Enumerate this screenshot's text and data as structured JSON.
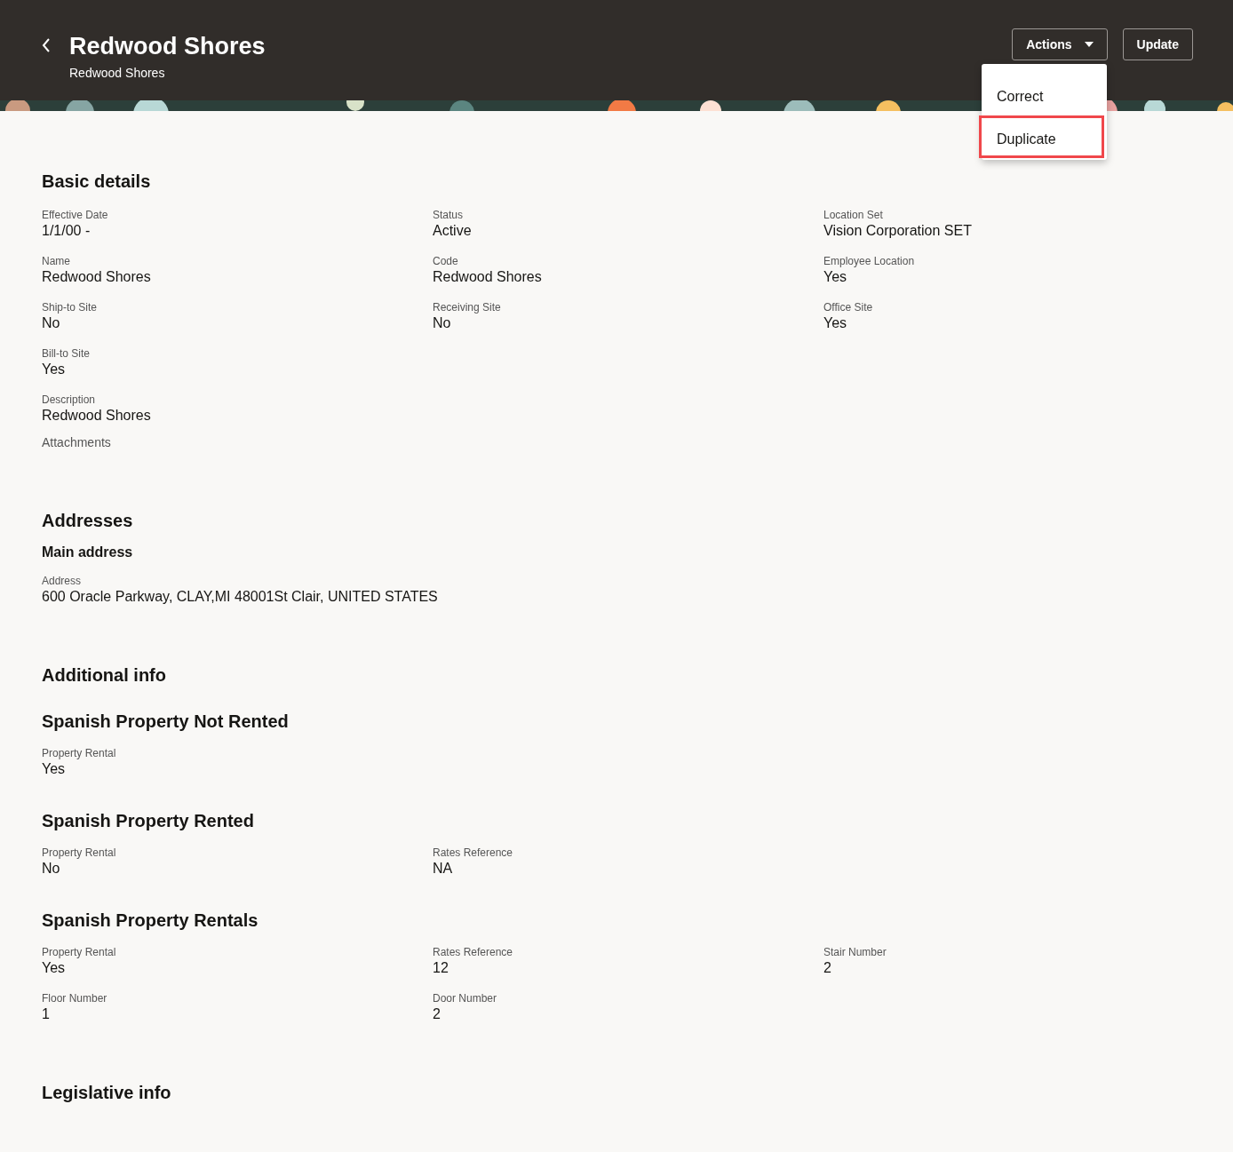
{
  "header": {
    "title": "Redwood Shores",
    "subtitle": "Redwood Shores",
    "buttons": [
      {
        "label": "Actions",
        "kind": "dropdown"
      },
      {
        "label": "Update",
        "kind": "plain"
      }
    ]
  },
  "menu": {
    "items": [
      {
        "label": "Correct",
        "selected": false
      },
      {
        "label": "Duplicate",
        "selected": true
      }
    ]
  },
  "blocks": [
    {
      "kind": "heading",
      "text": "Basic details"
    },
    {
      "kind": "fields",
      "rows": [
        [
          {
            "label": "Effective Date",
            "value": "1/1/00 -"
          },
          {
            "label": "Status",
            "value": "Active"
          },
          {
            "label": "Location Set",
            "value": "Vision Corporation SET"
          }
        ],
        [
          {
            "label": "Name",
            "value": "Redwood Shores"
          },
          {
            "label": "Code",
            "value": "Redwood Shores"
          },
          {
            "label": "Employee Location",
            "value": "Yes"
          }
        ],
        [
          {
            "label": "Ship-to Site",
            "value": "No"
          },
          {
            "label": "Receiving Site",
            "value": "No"
          },
          {
            "label": "Office Site",
            "value": "Yes"
          }
        ],
        [
          {
            "label": "Bill-to Site",
            "value": "Yes"
          }
        ],
        [
          {
            "label": "Description",
            "value": "Redwood Shores"
          }
        ]
      ]
    },
    {
      "kind": "link",
      "text": "Attachments"
    },
    {
      "kind": "heading",
      "text": "Addresses"
    },
    {
      "kind": "subheading",
      "text": "Main address"
    },
    {
      "kind": "fields",
      "rows": [
        [
          {
            "label": "Address",
            "value": "600 Oracle Parkway, CLAY,MI 48001St Clair, UNITED STATES"
          }
        ]
      ]
    },
    {
      "kind": "heading",
      "text": "Additional info"
    },
    {
      "kind": "group",
      "text": "Spanish Property Not Rented"
    },
    {
      "kind": "fields",
      "rows": [
        [
          {
            "label": "Property Rental",
            "value": "Yes"
          }
        ]
      ]
    },
    {
      "kind": "group",
      "text": "Spanish Property Rented"
    },
    {
      "kind": "fields",
      "rows": [
        [
          {
            "label": "Property Rental",
            "value": "No"
          },
          {
            "label": "Rates Reference",
            "value": "NA"
          }
        ]
      ]
    },
    {
      "kind": "group",
      "text": "Spanish Property Rentals"
    },
    {
      "kind": "fields",
      "rows": [
        [
          {
            "label": "Property Rental",
            "value": "Yes"
          },
          {
            "label": "Rates Reference",
            "value": "12"
          },
          {
            "label": "Stair Number",
            "value": "2"
          }
        ],
        [
          {
            "label": "Floor Number",
            "value": "1"
          },
          {
            "label": "Door Number",
            "value": "2"
          }
        ]
      ]
    },
    {
      "kind": "heading",
      "text": "Legislative info"
    }
  ]
}
